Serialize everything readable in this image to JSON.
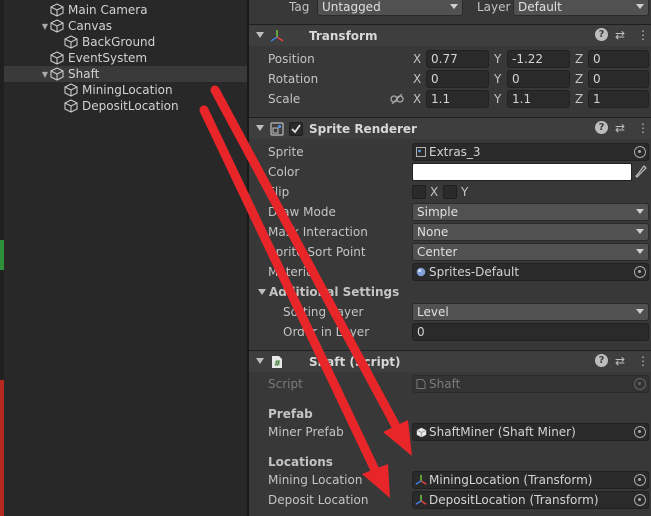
{
  "hierarchy": {
    "items": [
      {
        "label": "Main Camera",
        "indent": 1,
        "expandable": false,
        "selected": false
      },
      {
        "label": "Canvas",
        "indent": 1,
        "expandable": true,
        "selected": false
      },
      {
        "label": "BackGround",
        "indent": 2,
        "expandable": false,
        "selected": false
      },
      {
        "label": "EventSystem",
        "indent": 1,
        "expandable": false,
        "selected": false
      },
      {
        "label": "Shaft",
        "indent": 1,
        "expandable": true,
        "selected": true
      },
      {
        "label": "MiningLocation",
        "indent": 2,
        "expandable": false,
        "selected": false
      },
      {
        "label": "DepositLocation",
        "indent": 2,
        "expandable": false,
        "selected": false
      }
    ]
  },
  "header": {
    "tag_label": "Tag",
    "tag_value": "Untagged",
    "layer_label": "Layer",
    "layer_value": "Default"
  },
  "transform": {
    "title": "Transform",
    "position": {
      "label": "Position",
      "x": "0.77",
      "y": "-1.22",
      "z": "0"
    },
    "rotation": {
      "label": "Rotation",
      "x": "0",
      "y": "0",
      "z": "0"
    },
    "scale": {
      "label": "Scale",
      "x": "1.1",
      "y": "1.1",
      "z": "1"
    },
    "axis_x": "X",
    "axis_y": "Y",
    "axis_z": "Z"
  },
  "sprite_renderer": {
    "title": "Sprite Renderer",
    "sprite_label": "Sprite",
    "sprite_value": "Extras_3",
    "color_label": "Color",
    "color_value": "#ffffff",
    "flip_label": "Flip",
    "flip_x": "X",
    "flip_y": "Y",
    "draw_mode_label": "Draw Mode",
    "draw_mode_value": "Simple",
    "mask_label": "Mask Interaction",
    "mask_value": "None",
    "sort_point_label": "Sprite Sort Point",
    "sort_point_value": "Center",
    "material_label": "Material",
    "material_value": "Sprites-Default",
    "additional_title": "Additional Settings",
    "sorting_layer_label": "Sorting Layer",
    "sorting_layer_value": "Level",
    "order_label": "Order in Layer",
    "order_value": "0"
  },
  "shaft_script": {
    "title": "Shaft (Script)",
    "script_label": "Script",
    "script_value": "Shaft",
    "prefab_header": "Prefab",
    "miner_prefab_label": "Miner Prefab",
    "miner_prefab_value": "ShaftMiner (Shaft Miner)",
    "locations_header": "Locations",
    "mining_label": "Mining Location",
    "mining_value": "MiningLocation (Transform)",
    "deposit_label": "Deposit Location",
    "deposit_value": "DepositLocation (Transform)"
  },
  "colors": {
    "arrow": "#e8262a",
    "selection": "#3a3a3a",
    "inspector_bg": "#383838"
  }
}
